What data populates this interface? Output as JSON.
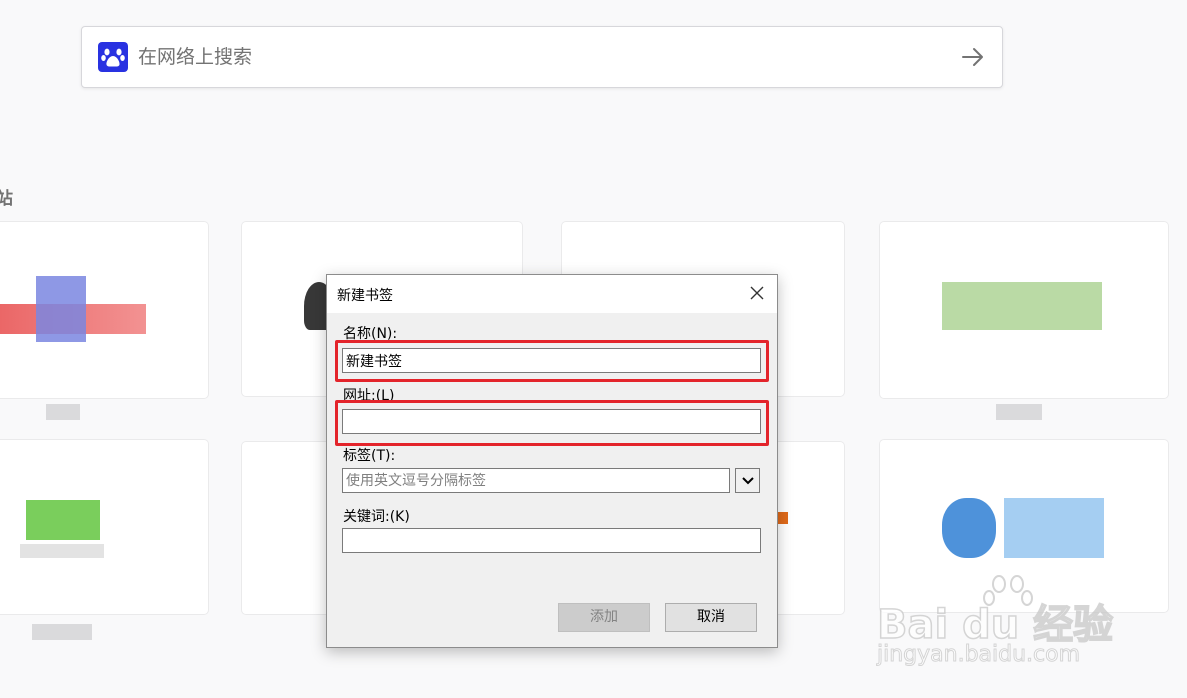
{
  "search": {
    "placeholder": "在网络上搜索",
    "engine_icon": "baidu-paw-icon",
    "submit_icon": "arrow-right-icon"
  },
  "section": {
    "title": "站"
  },
  "dialog": {
    "title": "新建书签",
    "name_label": "名称(N):",
    "name_value": "新建书签",
    "url_label": "网址:(L)",
    "url_value": "",
    "tags_label": "标签(T):",
    "tags_placeholder": "使用英文逗号分隔标签",
    "keyword_label": "关键词:(K)",
    "keyword_value": "",
    "add_button": "添加",
    "cancel_button": "取消"
  },
  "watermark": {
    "brand": "Bai du 经验",
    "url": "jingyan.baidu.com"
  },
  "colors": {
    "highlight": "#e3242b",
    "baidu_blue": "#2932e1"
  }
}
